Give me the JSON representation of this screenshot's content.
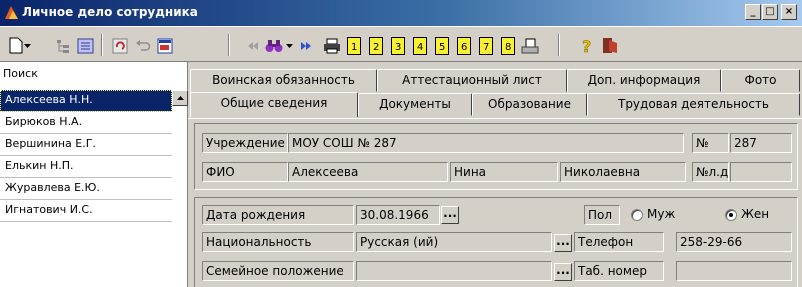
{
  "window": {
    "title": "Личное дело сотрудника",
    "minimize": "_",
    "maximize": "□",
    "close": "×"
  },
  "toolbar": {
    "icons": [
      "new-doc-icon",
      "dropdown-arrow-icon",
      "tree-view-icon",
      "notebook-icon",
      "refresh-icon",
      "undo-icon",
      "report-icon",
      "nav-first-icon",
      "binoculars-icon",
      "dropdown-arrow-icon",
      "nav-last-icon",
      "print-icon",
      "doc-1-icon",
      "doc-2-icon",
      "doc-3-icon",
      "doc-4-icon",
      "doc-5-icon",
      "doc-6-icon",
      "doc-7-icon",
      "doc-8-icon",
      "print-report-icon",
      "help-icon",
      "exit-icon"
    ]
  },
  "sidebar": {
    "search_label": "Поиск",
    "search_value": "",
    "employees": [
      "Алексеева Н.Н.",
      "Бирюков Н.А.",
      "Вершинина Е.Г.",
      "Елькин Н.П.",
      "Журавлева Е.Ю.",
      "Игнатович И.С."
    ]
  },
  "tabs": {
    "row1": [
      "Воинская обязанность",
      "Аттестационный лист",
      "Доп. информация",
      "Фото"
    ],
    "row2": [
      "Общие сведения",
      "Документы",
      "Образование",
      "Трудовая деятельность"
    ]
  },
  "form": {
    "institution_label": "Учреждение",
    "institution_value": "МОУ СОШ № 287",
    "number_label": "№",
    "number_value": "287",
    "fio_label": "ФИО",
    "last_name": "Алексеева",
    "first_name": "Нина",
    "patronymic": "Николаевна",
    "file_number_label": "№л.д",
    "file_number_value": "",
    "birthdate_label": "Дата рождения",
    "birthdate_value": "30.08.1966",
    "ellipsis": "...",
    "gender_label": "Пол",
    "gender_male": "Муж",
    "gender_female": "Жен",
    "gender_selected": "Жен",
    "nationality_label": "Национальность",
    "nationality_value": "Русская (ий)",
    "phone_label": "Телефон",
    "phone_value": "258-29-66",
    "marital_label": "Семейное положение",
    "marital_value": "",
    "tab_number_label": "Таб. номер",
    "tab_number_value": ""
  }
}
